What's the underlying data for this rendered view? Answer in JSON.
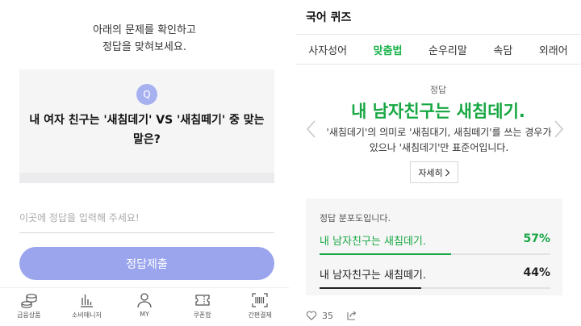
{
  "left": {
    "instruction_line1": "아래의 문제를 확인하고",
    "instruction_line2": "정답을 맞혀보세요.",
    "question_badge": "Q",
    "question_text": "내 여자 친구는 '새침데기' VS '새침떼기' 중 맞는 말은?",
    "input_placeholder": "이곳에 정답을 입력해 주세요!",
    "input_value": "",
    "submit_label": "정답제출",
    "tabs": [
      {
        "label": "금융상품",
        "icon": "coins-icon"
      },
      {
        "label": "소비매니저",
        "icon": "bar-chart-icon"
      },
      {
        "label": "MY",
        "icon": "person-icon"
      },
      {
        "label": "쿠폰함",
        "icon": "ticket-icon"
      },
      {
        "label": "간편결제",
        "icon": "barcode-icon"
      }
    ]
  },
  "right": {
    "title": "국어 퀴즈",
    "categories": [
      {
        "label": "사자성어",
        "active": false
      },
      {
        "label": "맞춤법",
        "active": true
      },
      {
        "label": "순우리말",
        "active": false
      },
      {
        "label": "속담",
        "active": false
      },
      {
        "label": "외래어",
        "active": false
      }
    ],
    "answer_label": "정답",
    "answer": "내 남자친구는 새침데기.",
    "description": "'새침데기'의 의미로 '새침대기, 새침떼기'를 쓰는 경우가 있으나 '새침데기'만 표준어입니다.",
    "more_label": "자세히",
    "distribution": {
      "title": "정답 분포도입니다.",
      "options": [
        {
          "text": "내 남자친구는 새침데기.",
          "percent_label": "57%",
          "percent": 57,
          "correct": true
        },
        {
          "text": "내 남자친구는 새침떼기.",
          "percent_label": "44%",
          "percent": 44,
          "correct": false
        }
      ]
    },
    "like_count": "35"
  },
  "colors": {
    "accent_green": "#17a743",
    "button_purple": "#9aa5ee",
    "badge_purple": "#a8b1f0"
  }
}
